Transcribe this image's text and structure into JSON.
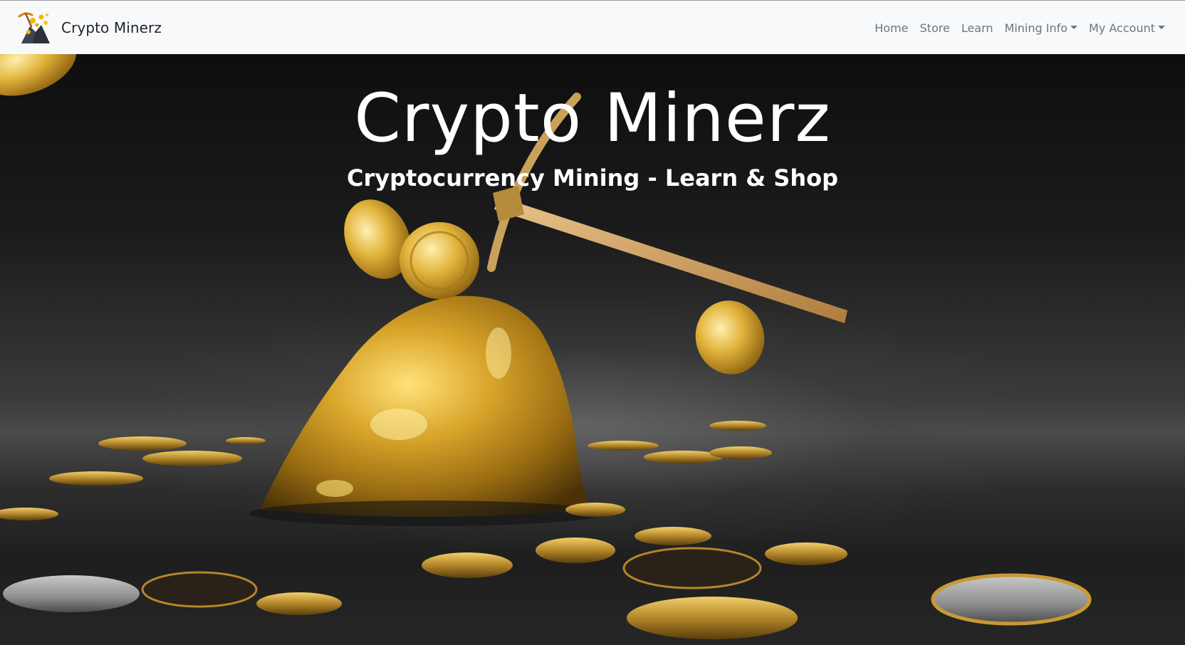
{
  "navbar": {
    "brand_name": "Crypto Minerz",
    "brand_logo_icon": "pickaxe-gold-logo-icon",
    "links": [
      {
        "label": "Home"
      },
      {
        "label": "Store"
      },
      {
        "label": "Learn"
      },
      {
        "label": "Mining Info",
        "dropdown": true
      },
      {
        "label": "My Account",
        "dropdown": true
      }
    ]
  },
  "hero": {
    "title": "Crypto Minerz",
    "subtitle": "Cryptocurrency Mining - Learn & Shop",
    "background_image": "gold-nugget-pickaxe-bitcoin-coins-illustration"
  },
  "colors": {
    "navbar_bg": "#f8f9fa",
    "nav_link": "#6c757d",
    "brand_text": "#212529",
    "hero_text": "#ffffff",
    "gold": "#d4a62a"
  }
}
